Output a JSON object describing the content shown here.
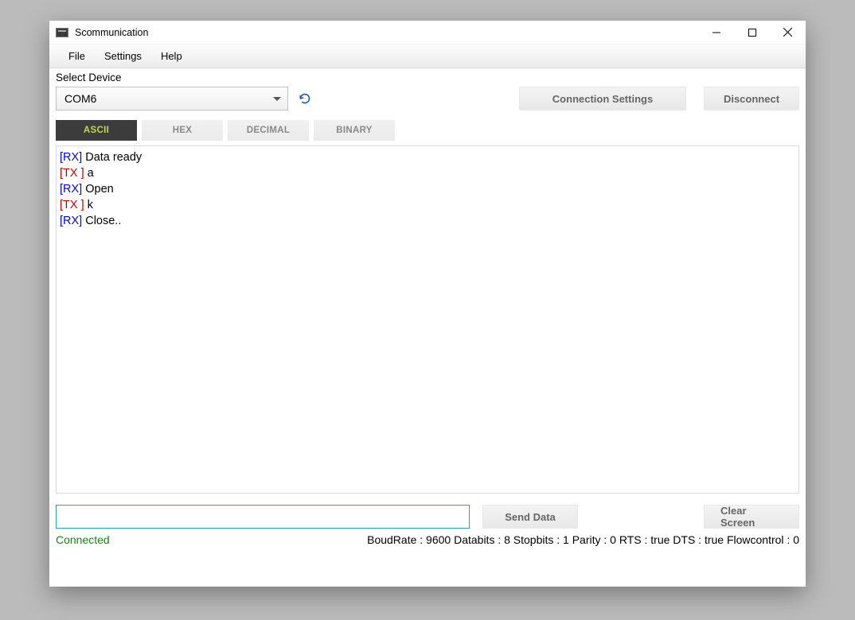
{
  "window": {
    "title": "Scommunication"
  },
  "menu": {
    "file": "File",
    "settings": "Settings",
    "help": "Help"
  },
  "device": {
    "label": "Select Device",
    "selected": "COM6"
  },
  "buttons": {
    "connection_settings": "Connection Settings",
    "disconnect": "Disconnect",
    "send_data": "Send Data",
    "clear_screen": "Clear Screen"
  },
  "tabs": {
    "ascii": "ASCII",
    "hex": "HEX",
    "decimal": "DECIMAL",
    "binary": "BINARY"
  },
  "terminal": {
    "lines": [
      {
        "tag": "[RX]",
        "cls": "rx",
        "text": " Data ready"
      },
      {
        "tag": "[TX ]",
        "cls": "tx",
        "text": " a"
      },
      {
        "tag": "[RX]",
        "cls": "rx",
        "text": " Open"
      },
      {
        "tag": "[TX ]",
        "cls": "tx",
        "text": " k"
      },
      {
        "tag": "[RX]",
        "cls": "rx",
        "text": " Close.."
      }
    ]
  },
  "input": {
    "value": ""
  },
  "status": {
    "connected": "Connected",
    "params": "BoudRate : 9600 Databits : 8 Stopbits : 1 Parity : 0 RTS : true DTS : true Flowcontrol : 0"
  }
}
